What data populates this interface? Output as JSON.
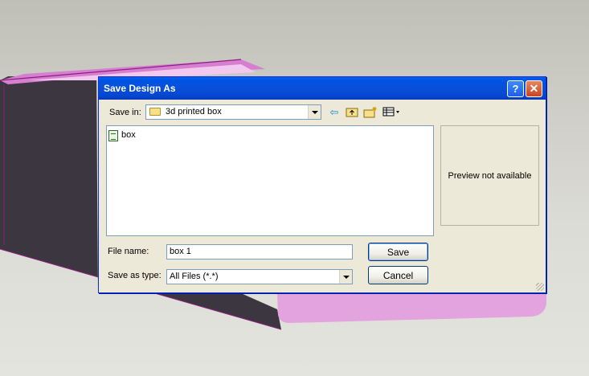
{
  "dialog": {
    "title": "Save Design As",
    "help_button": "?",
    "close_button": "✕",
    "save_in_label": "Save in:",
    "save_in_value": "3d printed box",
    "files": [
      {
        "name": "box"
      }
    ],
    "preview_text": "Preview not available",
    "file_name_label": "File name:",
    "file_name_value": "box 1",
    "save_as_type_label": "Save as type:",
    "save_as_type_value": "All Files (*.*)",
    "save_button": "Save",
    "cancel_button": "Cancel"
  },
  "toolbar": {
    "icons": [
      "back-arrow-icon",
      "up-folder-icon",
      "new-folder-icon",
      "view-menu-icon"
    ]
  },
  "colors": {
    "titlebar": "#0054e3",
    "dialog_bg": "#ece9d8",
    "model_pink": "#e8a0e0",
    "model_dark": "#3a3540"
  }
}
